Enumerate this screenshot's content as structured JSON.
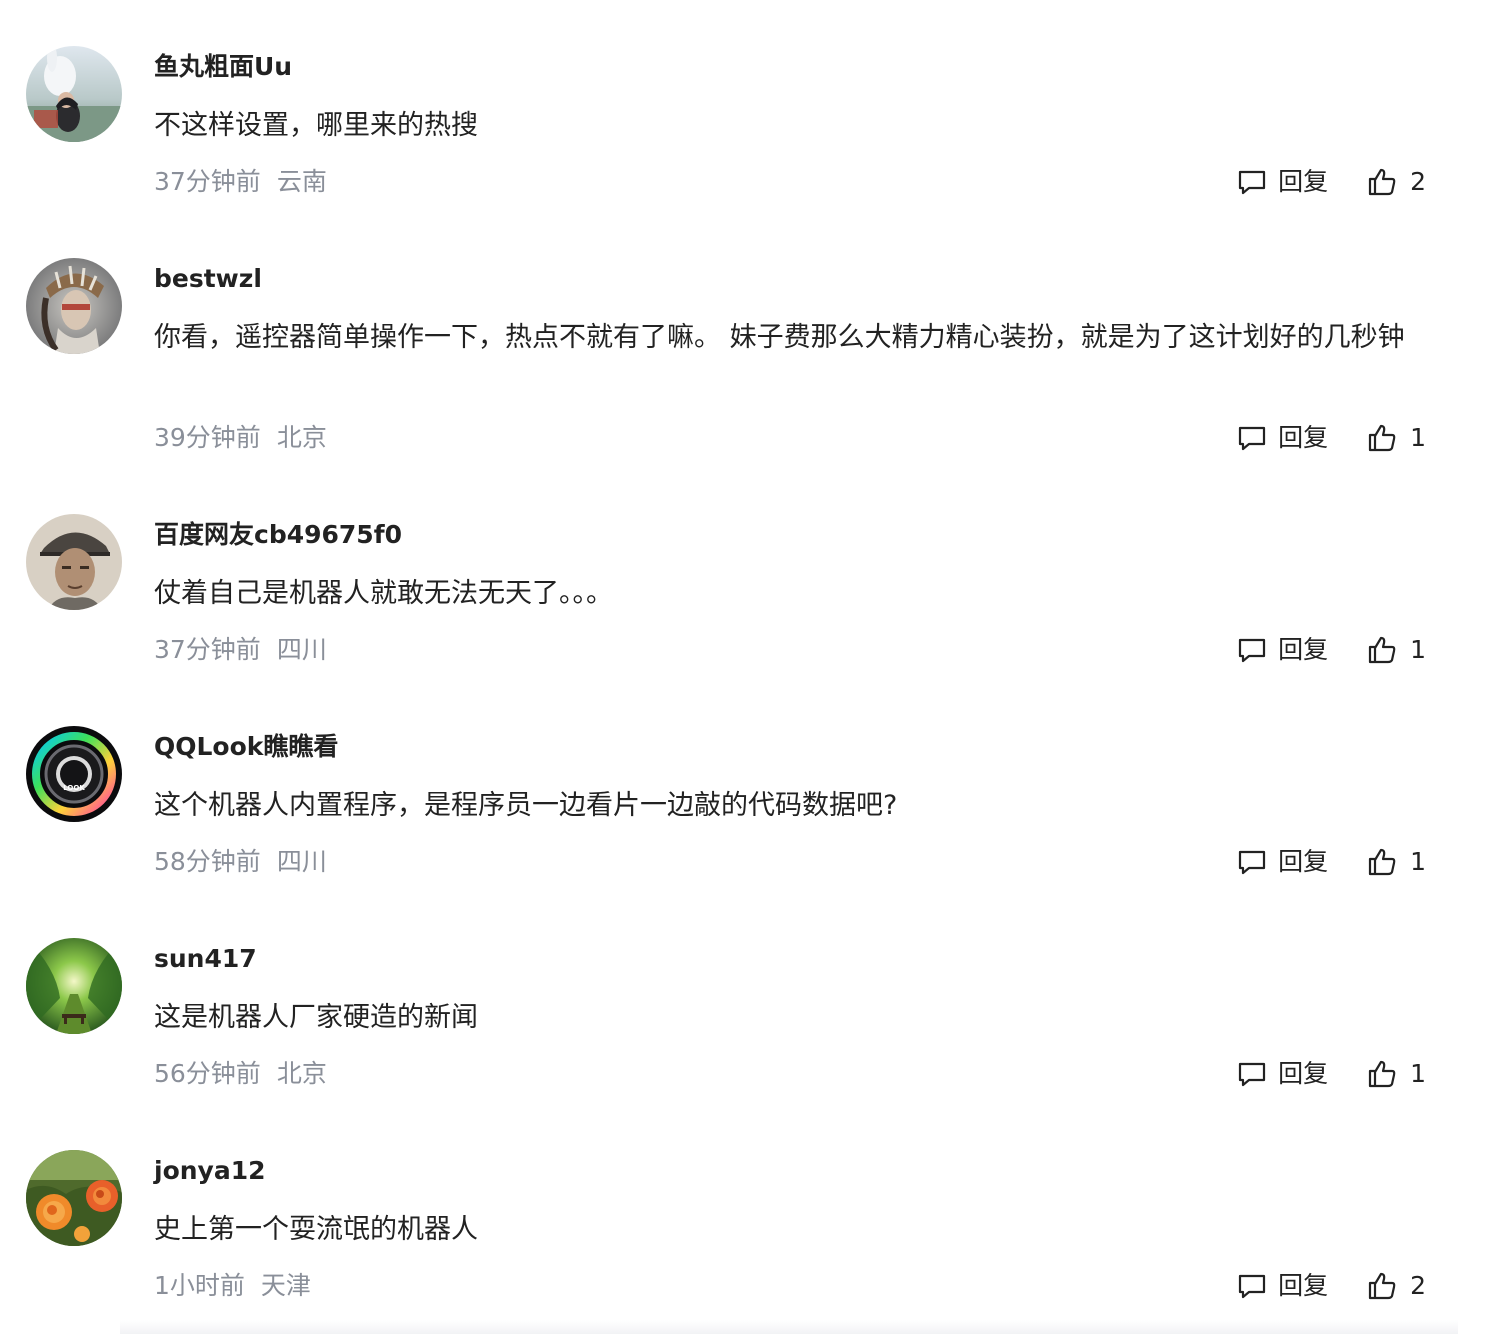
{
  "reply_label": "回复",
  "comments": [
    {
      "username": "鱼丸粗面Uu",
      "content": "不这样设置，哪里来的热搜",
      "time": "37分钟前",
      "location": "云南",
      "likes": "2",
      "avatar": "rabbit-photo"
    },
    {
      "username": "bestwzl",
      "content": "你看，遥控器简单操作一下，热点不就有了嘛。 妹子费那么大精力精心装扮，就是为了这计划好的几秒钟",
      "time": "39分钟前",
      "location": "北京",
      "likes": "1",
      "avatar": "feather-portrait"
    },
    {
      "username": "百度网友cb49675f0",
      "content": "仗着自己是机器人就敢无法无天了。。。",
      "time": "37分钟前",
      "location": "四川",
      "likes": "1",
      "avatar": "cap-portrait"
    },
    {
      "username": "QQLook瞧瞧看",
      "content": "这个机器人内置程序，是程序员一边看片一边敲的代码数据吧?",
      "time": "58分钟前",
      "location": "四川",
      "likes": "1",
      "avatar": "look-logo"
    },
    {
      "username": "sun417",
      "content": "这是机器人厂家硬造的新闻",
      "time": "56分钟前",
      "location": "北京",
      "likes": "1",
      "avatar": "green-tunnel"
    },
    {
      "username": "jonya12",
      "content": "史上第一个耍流氓的机器人",
      "time": "1小时前",
      "location": "天津",
      "likes": "2",
      "avatar": "orange-roses"
    }
  ]
}
